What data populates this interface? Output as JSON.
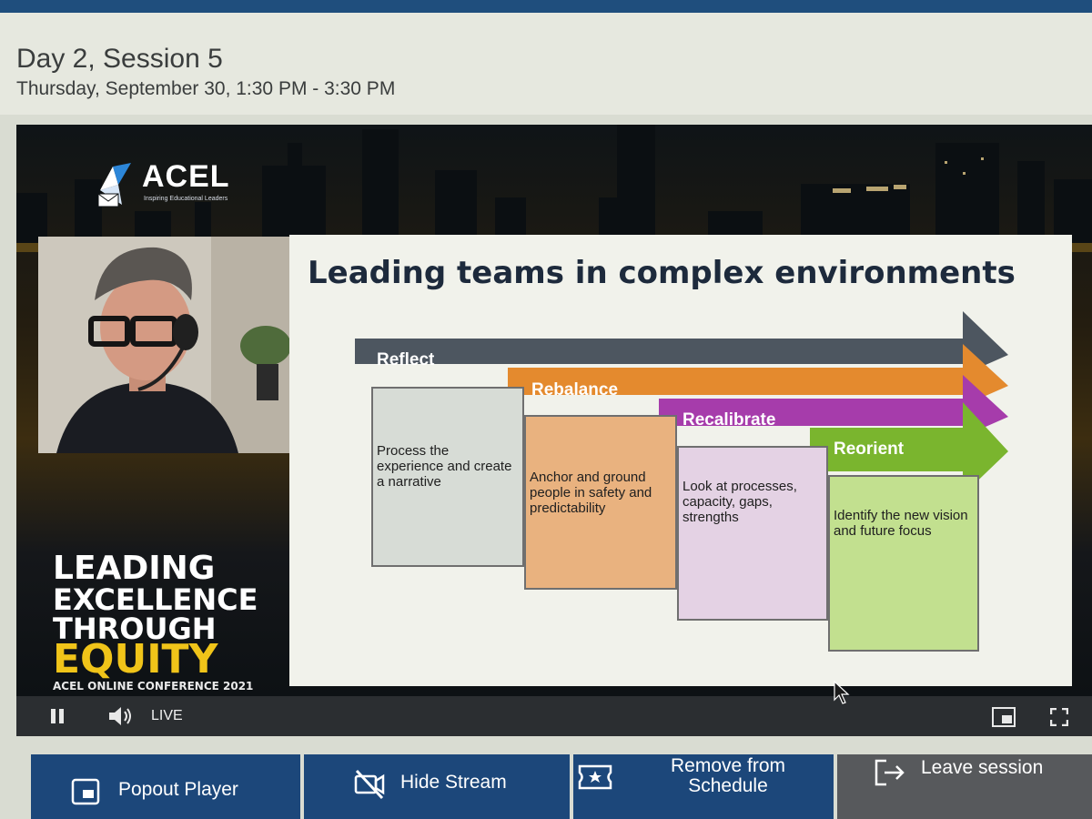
{
  "session": {
    "title": "Day 2, Session 5",
    "time": "Thursday, September 30, 1:30 PM - 3:30 PM"
  },
  "stream": {
    "logo": {
      "text": "ACEL",
      "tagline": "Inspiring Educational Leaders"
    },
    "conference": {
      "line1": "LEADING",
      "line2": "EXCELLENCE",
      "line3": "THROUGH",
      "line4": "EQUITY",
      "line5": "ACEL ONLINE CONFERENCE 2021"
    },
    "slide": {
      "title": "Leading teams in complex environments",
      "phases": [
        {
          "label": "Reflect",
          "text": "Process the experience and create a narrative",
          "color": "#4d5660"
        },
        {
          "label": "Rebalance",
          "text": "Anchor and ground people in safety and predictability",
          "color": "#e48a2e"
        },
        {
          "label": "Recalibrate",
          "text": "Look at processes, capacity, gaps, strengths",
          "color": "#a63cab"
        },
        {
          "label": "Reorient",
          "text": "Identify the new vision and future focus",
          "color": "#7ab52e"
        }
      ]
    },
    "controls": {
      "live_label": "LIVE",
      "icons": [
        "pause-icon",
        "volume-icon",
        "picture-in-picture-icon",
        "fullscreen-icon"
      ]
    }
  },
  "actions": {
    "popout": "Popout Player",
    "hide_stream": "Hide Stream",
    "remove_line1": "Remove from",
    "remove_line2": "Schedule",
    "leave": "Leave session"
  },
  "colors": {
    "header_bar": "#1f4e7d",
    "button_blue": "#1c477a",
    "button_grey": "#57595c"
  }
}
